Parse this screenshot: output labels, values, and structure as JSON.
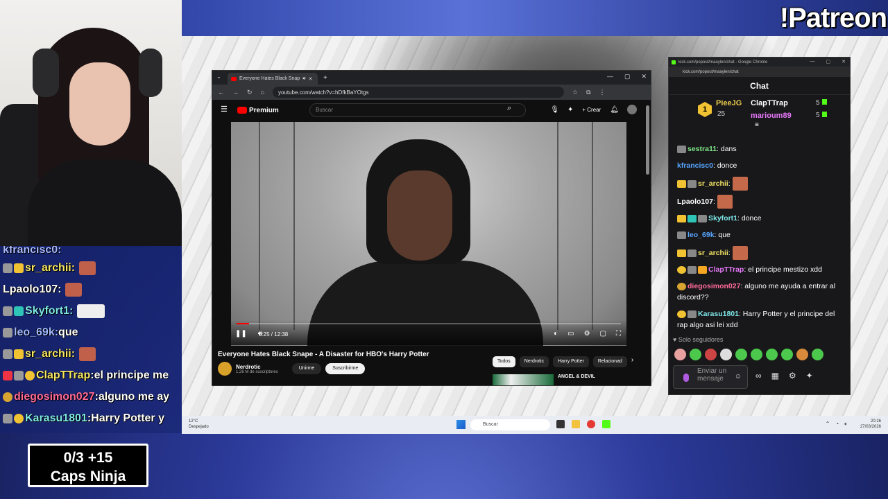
{
  "overlay": {
    "patreon": "!Patreon",
    "chat": [
      {
        "user": "kfrancisc0",
        "sep": " :",
        "msg": ""
      },
      {
        "user": "sr_archii",
        "sep": " :",
        "msg": ""
      },
      {
        "user": "Lpaolo107",
        "sep": " :",
        "msg": ""
      },
      {
        "user": "Skyfort1",
        "sep": " :",
        "msg": ""
      },
      {
        "user": "leo_69k",
        "sep": " :",
        "msg": " que"
      },
      {
        "user": "sr_archii",
        "sep": " :",
        "msg": ""
      },
      {
        "user": "ClapTTrap",
        "sep": " :",
        "msg": " el principe me"
      },
      {
        "user": "diegosimon027",
        "sep": " :",
        "msg": " alguno me ay"
      },
      {
        "user": "Karasu1801",
        "sep": " :",
        "msg": " Harry Potter y"
      }
    ],
    "caps_score": "0/3  +15",
    "caps_label": "Caps Ninja"
  },
  "browser": {
    "tab_title": "Everyone Hates Black Snap",
    "url": "youtube.com/watch?v=hDfkBaYOtgs",
    "controls": [
      "—",
      "▢",
      "✕"
    ]
  },
  "youtube": {
    "logo": "Premium",
    "search_placeholder": "Buscar",
    "create": "Crear",
    "time": "0:25 / 12:38",
    "progress": 0.033,
    "title": "Everyone Hates Black Snape - A Disaster for HBO's Harry Potter",
    "channel": "Nerdrotic",
    "subs": "1,26 M de suscriptores",
    "join": "Unirme",
    "subscribe": "Suscribirme",
    "chips": [
      "Todos",
      "Nerdrotic",
      "Harry Potter",
      "Relacionad"
    ],
    "rec_title": "ANGEL & DEVIL"
  },
  "taskbar": {
    "weather_temp": "12°C",
    "weather_desc": "Despejado",
    "search": "Buscar",
    "time": "20:26",
    "date": "27/03/2026"
  },
  "kick": {
    "window_title": "kick.com/popout/maaylen/chat - Google Chrome",
    "url": "kick.com/popout/maaylen/chat",
    "header": "Chat",
    "gifters": [
      {
        "name": "PieeJG",
        "count": "25"
      },
      {
        "name": "ClapTTrap",
        "count": "5"
      },
      {
        "name": "marioum89",
        "count": "5"
      }
    ],
    "pin_rank": "1",
    "messages": [
      {
        "user": "sestra11",
        "color": "#7ee787",
        "text": ": dans"
      },
      {
        "user": "kfrancisc0",
        "color": "#58a6ff",
        "text": ": donce"
      },
      {
        "user": "sr_archii",
        "color": "#f5e663",
        "text": ":"
      },
      {
        "user": "Lpaolo107",
        "color": "#ffffff",
        "text": ":"
      },
      {
        "user": "Skyfort1",
        "color": "#7ee7e7",
        "text": ": donce"
      },
      {
        "user": "leo_69k",
        "color": "#58a6ff",
        "text": ": que"
      },
      {
        "user": "sr_archii",
        "color": "#f5e663",
        "text": ":"
      },
      {
        "user": "ClapTTrap",
        "color": "#e879f9",
        "text": ": el principe mestizo xdd"
      },
      {
        "user": "diegosimon027",
        "color": "#ff6b9a",
        "text": ": alguno me ayuda a entrar al discord??"
      },
      {
        "user": "Karasu1801",
        "color": "#7ee7e7",
        "text": ": Harry Potter y el principe del rap algo asi lei xdd"
      }
    ],
    "followers_only": "Solo seguidores",
    "input_placeholder": "Enviar un mensaje"
  }
}
